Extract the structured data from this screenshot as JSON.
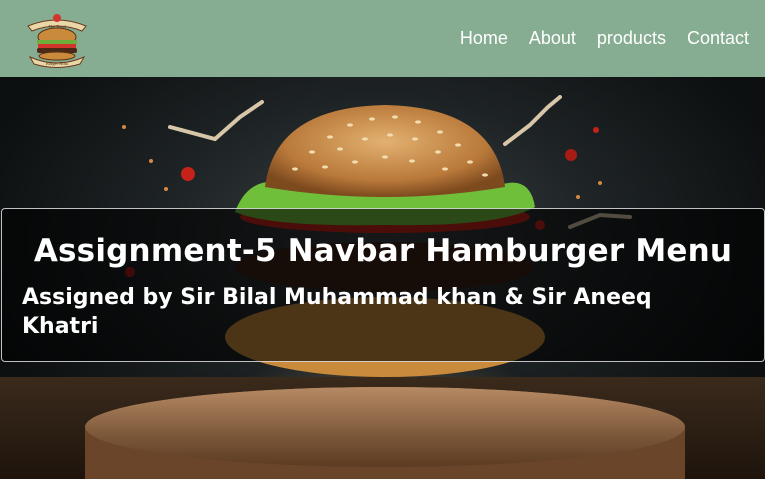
{
  "navbar": {
    "logo": {
      "icon": "burger-logo-icon",
      "text_top": "The Food",
      "text_bottom": "Burger Bliss"
    },
    "links": [
      "Home",
      "About",
      "products",
      "Contact"
    ],
    "colors": {
      "background": "#86ad91",
      "link": "#ffffff"
    }
  },
  "hero": {
    "background_image": "burger-hero-image",
    "title": "Assignment-5 Navbar Hamburger Menu",
    "subtitle": "Assigned by Sir Bilal Muhammad khan & Sir Aneeq Khatri"
  }
}
